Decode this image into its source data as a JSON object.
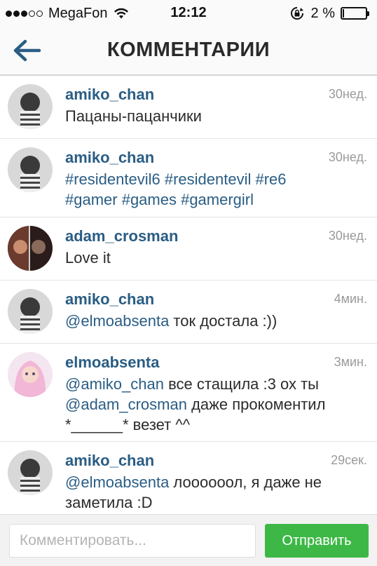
{
  "status_bar": {
    "carrier": "MegaFon",
    "time": "12:12",
    "battery_text": "2 %",
    "battery_level": 0.02,
    "signal_icon": "signal-dots-icon",
    "wifi_icon": "wifi-icon",
    "rotation_lock_icon": "rotation-lock-icon"
  },
  "nav": {
    "title": "КОММЕНТАРИИ",
    "back_icon": "arrow-left-icon",
    "accent": "#2a5d84"
  },
  "comments": [
    {
      "user": "amiko_chan",
      "time": "30нед.",
      "parts": [
        {
          "t": "Пацаны-пацанчики",
          "tag": false
        }
      ]
    },
    {
      "user": "amiko_chan",
      "time": "30нед.",
      "parts": [
        {
          "t": "#residentevil6 #residentevil  #re6 #gamer #games #gamergirl",
          "tag": true
        }
      ]
    },
    {
      "user": "adam_crosman",
      "time": "30нед.",
      "parts": [
        {
          "t": "Love it",
          "tag": false
        }
      ]
    },
    {
      "user": "amiko_chan",
      "time": "4мин.",
      "parts": [
        {
          "t": "@elmoabsenta",
          "tag": true
        },
        {
          "t": " ток достала :))",
          "tag": false
        }
      ]
    },
    {
      "user": "elmoabsenta",
      "time": "3мин.",
      "parts": [
        {
          "t": "@amiko_chan",
          "tag": true
        },
        {
          "t": " все стащила :3 ох ты ",
          "tag": false
        },
        {
          "t": "@adam_crosman",
          "tag": true
        },
        {
          "t": " даже прокоментил *______* везет ^^",
          "tag": false
        }
      ]
    },
    {
      "user": "amiko_chan",
      "time": "29сек.",
      "parts": [
        {
          "t": "@elmoabsenta",
          "tag": true
        },
        {
          "t": " лоооооол, я даже не заметила :D",
          "tag": false
        }
      ]
    }
  ],
  "composer": {
    "placeholder": "Комментировать...",
    "value": "",
    "send_label": "Отправить",
    "send_color": "#3db846"
  }
}
